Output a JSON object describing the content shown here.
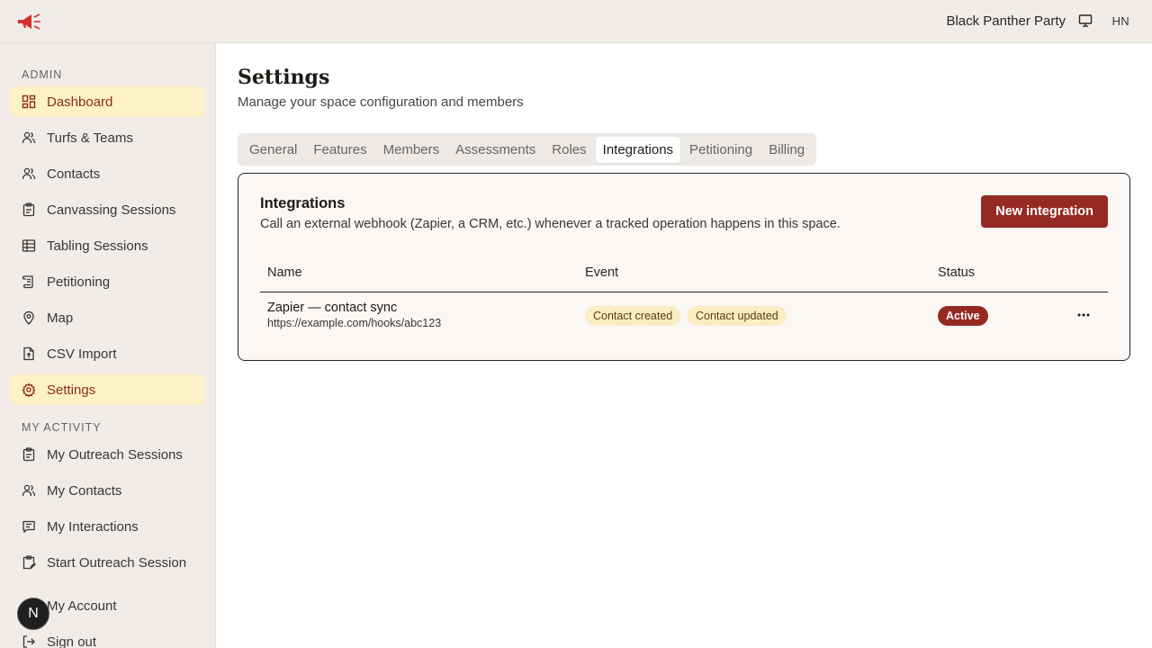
{
  "topbar": {
    "org_name": "Black Panther Party",
    "user_initials": "HN"
  },
  "sidebar": {
    "admin_label": "ADMIN",
    "admin_items": [
      {
        "label": "Dashboard",
        "icon": "dashboard-icon"
      },
      {
        "label": "Turfs & Teams",
        "icon": "users-icon"
      },
      {
        "label": "Contacts",
        "icon": "users-icon"
      },
      {
        "label": "Canvassing Sessions",
        "icon": "clipboard-icon"
      },
      {
        "label": "Tabling Sessions",
        "icon": "table-icon"
      },
      {
        "label": "Petitioning",
        "icon": "scroll-icon"
      },
      {
        "label": "Map",
        "icon": "map-pin-icon"
      },
      {
        "label": "CSV Import",
        "icon": "file-upload-icon"
      },
      {
        "label": "Settings",
        "icon": "gear-icon"
      }
    ],
    "activity_label": "MY ACTIVITY",
    "activity_items": [
      {
        "label": "My Outreach Sessions",
        "icon": "clipboard-icon"
      },
      {
        "label": "My Contacts",
        "icon": "users-icon"
      },
      {
        "label": "My Interactions",
        "icon": "message-icon"
      },
      {
        "label": "Start Outreach Session",
        "icon": "clipboard-edit-icon"
      }
    ],
    "account_label": "My Account",
    "signout_label": "Sign out",
    "avatar_letter": "N"
  },
  "page": {
    "title": "Settings",
    "subtitle": "Manage your space configuration and members"
  },
  "tabs": [
    "General",
    "Features",
    "Members",
    "Assessments",
    "Roles",
    "Integrations",
    "Petitioning",
    "Billing"
  ],
  "active_tab": "Integrations",
  "integrations": {
    "title": "Integrations",
    "description": "Call an external webhook (Zapier, a CRM, etc.) whenever a tracked operation happens in this space.",
    "new_button": "New integration",
    "columns": {
      "name": "Name",
      "event": "Event",
      "status": "Status"
    },
    "rows": [
      {
        "name": "Zapier — contact sync",
        "url": "https://example.com/hooks/abc123",
        "events": [
          "Contact created",
          "Contact updated"
        ],
        "status": "Active"
      }
    ]
  },
  "colors": {
    "accent": "#952a22",
    "active_nav_bg": "#fdf2c6",
    "chip_bg": "#fbedc4"
  }
}
